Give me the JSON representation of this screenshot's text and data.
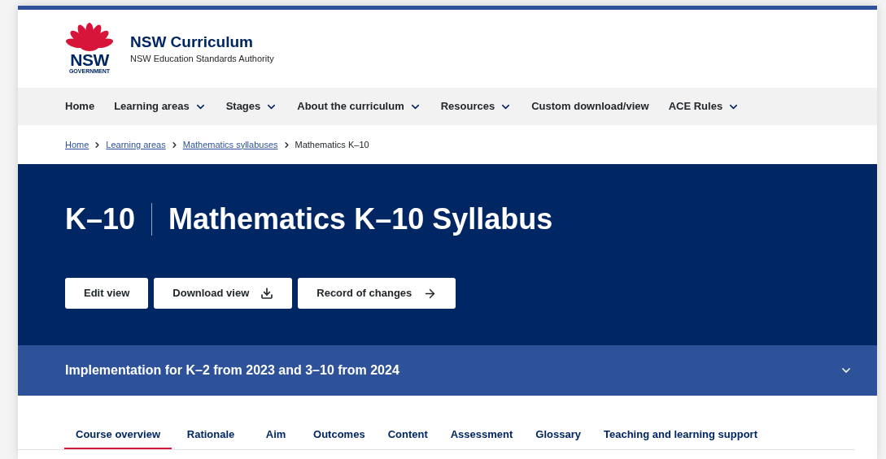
{
  "logo": {
    "wordmark": "NSW",
    "subtitle": "GOVERNMENT"
  },
  "site": {
    "title": "NSW Curriculum",
    "subtitle": "NSW Education Standards Authority"
  },
  "nav": [
    {
      "label": "Home",
      "has_menu": false
    },
    {
      "label": "Learning areas",
      "has_menu": true
    },
    {
      "label": "Stages",
      "has_menu": true
    },
    {
      "label": "About the curriculum",
      "has_menu": true
    },
    {
      "label": "Resources",
      "has_menu": true
    },
    {
      "label": "Custom download/view",
      "has_menu": false
    },
    {
      "label": "ACE Rules",
      "has_menu": true
    }
  ],
  "breadcrumb": [
    {
      "label": "Home",
      "link": true
    },
    {
      "label": "Learning areas",
      "link": true
    },
    {
      "label": "Mathematics syllabuses",
      "link": true
    },
    {
      "label": "Mathematics K–10",
      "link": false
    }
  ],
  "hero": {
    "stage": "K–10",
    "title": "Mathematics K–10 Syllabus",
    "buttons": [
      {
        "label": "Edit view",
        "kind": "plain"
      },
      {
        "label": "Download view",
        "kind": "download"
      },
      {
        "label": "Record of changes",
        "kind": "link"
      }
    ]
  },
  "implementation": {
    "label": "Implementation for K–2 from 2023 and 3–10 from 2024",
    "expanded": false
  },
  "tabs": [
    {
      "label": "Course overview",
      "selected": true
    },
    {
      "label": "Rationale",
      "selected": false
    },
    {
      "label": "Aim",
      "selected": false
    },
    {
      "label": "Outcomes",
      "selected": false
    },
    {
      "label": "Content",
      "selected": false
    },
    {
      "label": "Assessment",
      "selected": false
    },
    {
      "label": "Glossary",
      "selected": false
    },
    {
      "label": "Teaching and learning support",
      "selected": false
    }
  ]
}
